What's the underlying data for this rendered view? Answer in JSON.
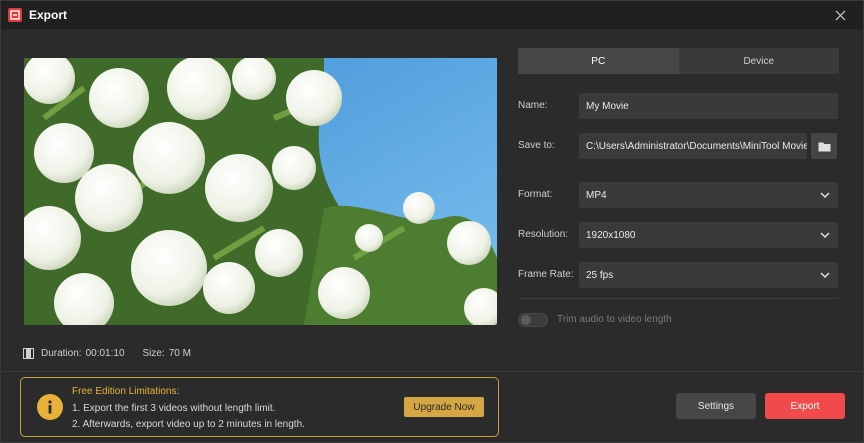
{
  "window": {
    "title": "Export"
  },
  "preview": {
    "duration_label": "Duration:",
    "duration": "00:01:10",
    "size_label": "Size:",
    "size": "70 M"
  },
  "tabs": [
    {
      "label": "PC",
      "active": true
    },
    {
      "label": "Device",
      "active": false
    }
  ],
  "form": {
    "name_label": "Name:",
    "name_value": "My Movie",
    "save_label": "Save to:",
    "save_value": "C:\\Users\\Administrator\\Documents\\MiniTool Movie",
    "format_label": "Format:",
    "format_value": "MP4",
    "resolution_label": "Resolution:",
    "resolution_value": "1920x1080",
    "framerate_label": "Frame Rate:",
    "framerate_value": "25 fps"
  },
  "trim": {
    "label": "Trim audio to video length",
    "enabled": false
  },
  "limitations": {
    "title": "Free Edition Limitations:",
    "line1": "1. Export the first 3 videos without length limit.",
    "line2": "2. Afterwards, export video up to 2 minutes in length.",
    "upgrade_label": "Upgrade Now"
  },
  "actions": {
    "settings_label": "Settings",
    "export_label": "Export"
  },
  "colors": {
    "accent": "#f04a4a",
    "warning": "#e8b23a",
    "upgrade": "#d4a744",
    "sky": "#5aa7de"
  },
  "icons": [
    "app-logo-icon",
    "close-icon",
    "film-icon",
    "folder-icon",
    "chevron-down-icon",
    "info-icon"
  ]
}
